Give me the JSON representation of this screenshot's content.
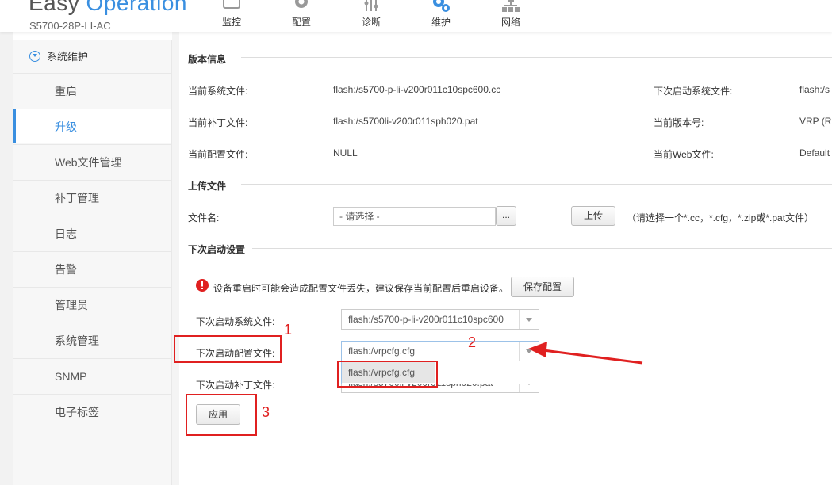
{
  "header": {
    "logo_part1": "Easy",
    "logo_part2": "Operation",
    "model": "S5700-28P-LI-AC",
    "nav": [
      {
        "label": "监控",
        "icon": "monitor-icon"
      },
      {
        "label": "配置",
        "icon": "gear-icon"
      },
      {
        "label": "诊断",
        "icon": "diagnose-icon"
      },
      {
        "label": "维护",
        "icon": "maintenance-icon",
        "active": true
      },
      {
        "label": "网络",
        "icon": "network-icon"
      }
    ]
  },
  "sidebar": {
    "title": "系统维护",
    "items": [
      {
        "label": "重启"
      },
      {
        "label": "升级",
        "active": true
      },
      {
        "label": "Web文件管理"
      },
      {
        "label": "补丁管理"
      },
      {
        "label": "日志"
      },
      {
        "label": "告警"
      },
      {
        "label": "管理员"
      },
      {
        "label": "系统管理"
      },
      {
        "label": "SNMP"
      },
      {
        "label": "电子标签"
      }
    ]
  },
  "version_info": {
    "title": "版本信息",
    "current_system_file_label": "当前系统文件:",
    "current_system_file": "flash:/s5700-p-li-v200r011c10spc600.cc",
    "next_system_file_label": "下次启动系统文件:",
    "next_system_file": "flash:/s",
    "current_patch_label": "当前补丁文件:",
    "current_patch": "flash:/s5700li-v200r011sph020.pat",
    "current_version_label": "当前版本号:",
    "current_version": "VRP (R",
    "current_config_label": "当前配置文件:",
    "current_config": "NULL",
    "current_web_label": "当前Web文件:",
    "current_web": "Default"
  },
  "upload": {
    "title": "上传文件",
    "file_name_label": "文件名:",
    "file_placeholder": "- 请选择 -",
    "browse_label": "...",
    "upload_button": "上传",
    "hint": "（请选择一个*.cc，*.cfg，*.zip或*.pat文件）"
  },
  "next_startup": {
    "title": "下次启动设置",
    "warning": "设备重启时可能会造成配置文件丢失，建议保存当前配置后重启设备。",
    "save_config_button": "保存配置",
    "system_file_label": "下次启动系统文件:",
    "system_file_value": "flash:/s5700-p-li-v200r011c10spc600",
    "config_file_label": "下次启动配置文件:",
    "config_file_value": "flash:/vrpcfg.cfg",
    "config_dropdown_option": "flash:/vrpcfg.cfg",
    "patch_file_label": "下次启动补丁文件:",
    "patch_file_value": "flash:/s5700li-v200r011sph020.pat",
    "apply_button": "应用"
  },
  "annotations": {
    "num1": "1",
    "num2": "2",
    "num3": "3",
    "color": "#e02020"
  }
}
